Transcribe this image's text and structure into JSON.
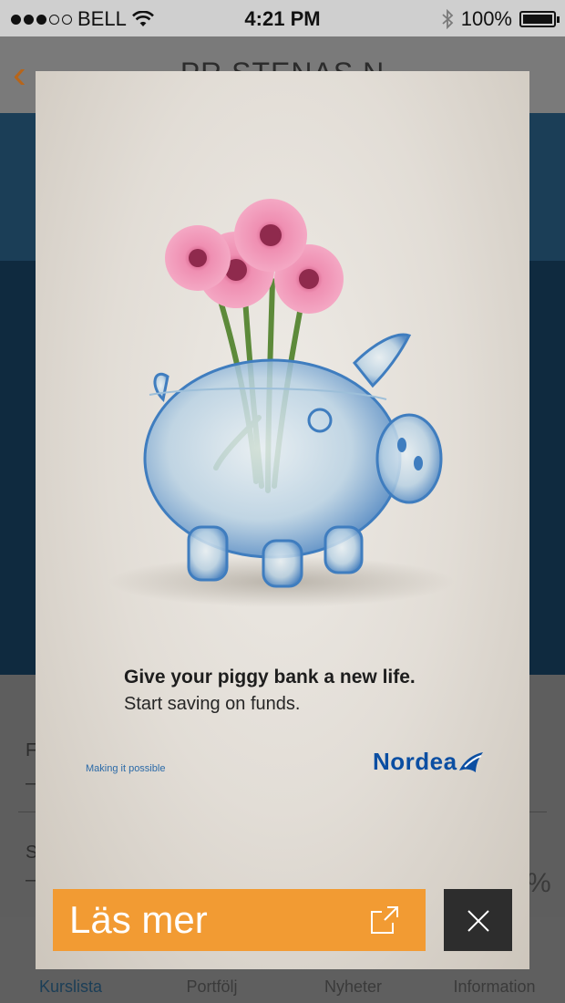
{
  "status_bar": {
    "carrier": "BELL",
    "time": "4:21 PM",
    "battery": "100%",
    "icons": [
      "wifi-icon",
      "bluetooth-icon",
      "battery-icon"
    ]
  },
  "app": {
    "nav_title": "PR STENAS N",
    "info_labels": {
      "row1": "F",
      "row1_value": "–",
      "row2": "S",
      "row2_value": "–",
      "row2_percent": "%"
    },
    "tabs": [
      {
        "label": "Kurslista",
        "active": true
      },
      {
        "label": "Portfölj",
        "active": false
      },
      {
        "label": "Nyheter",
        "active": false
      },
      {
        "label": "Information",
        "active": false
      }
    ]
  },
  "ad": {
    "headline": "Give your piggy bank a new life.",
    "subline": "Start saving on funds.",
    "tagline": "Making it possible",
    "brand": "Nordea",
    "cta_label": "Läs mer",
    "colors": {
      "cta": "#f29b33",
      "close": "#2d2d2d",
      "brand": "#0b4ea2"
    }
  }
}
